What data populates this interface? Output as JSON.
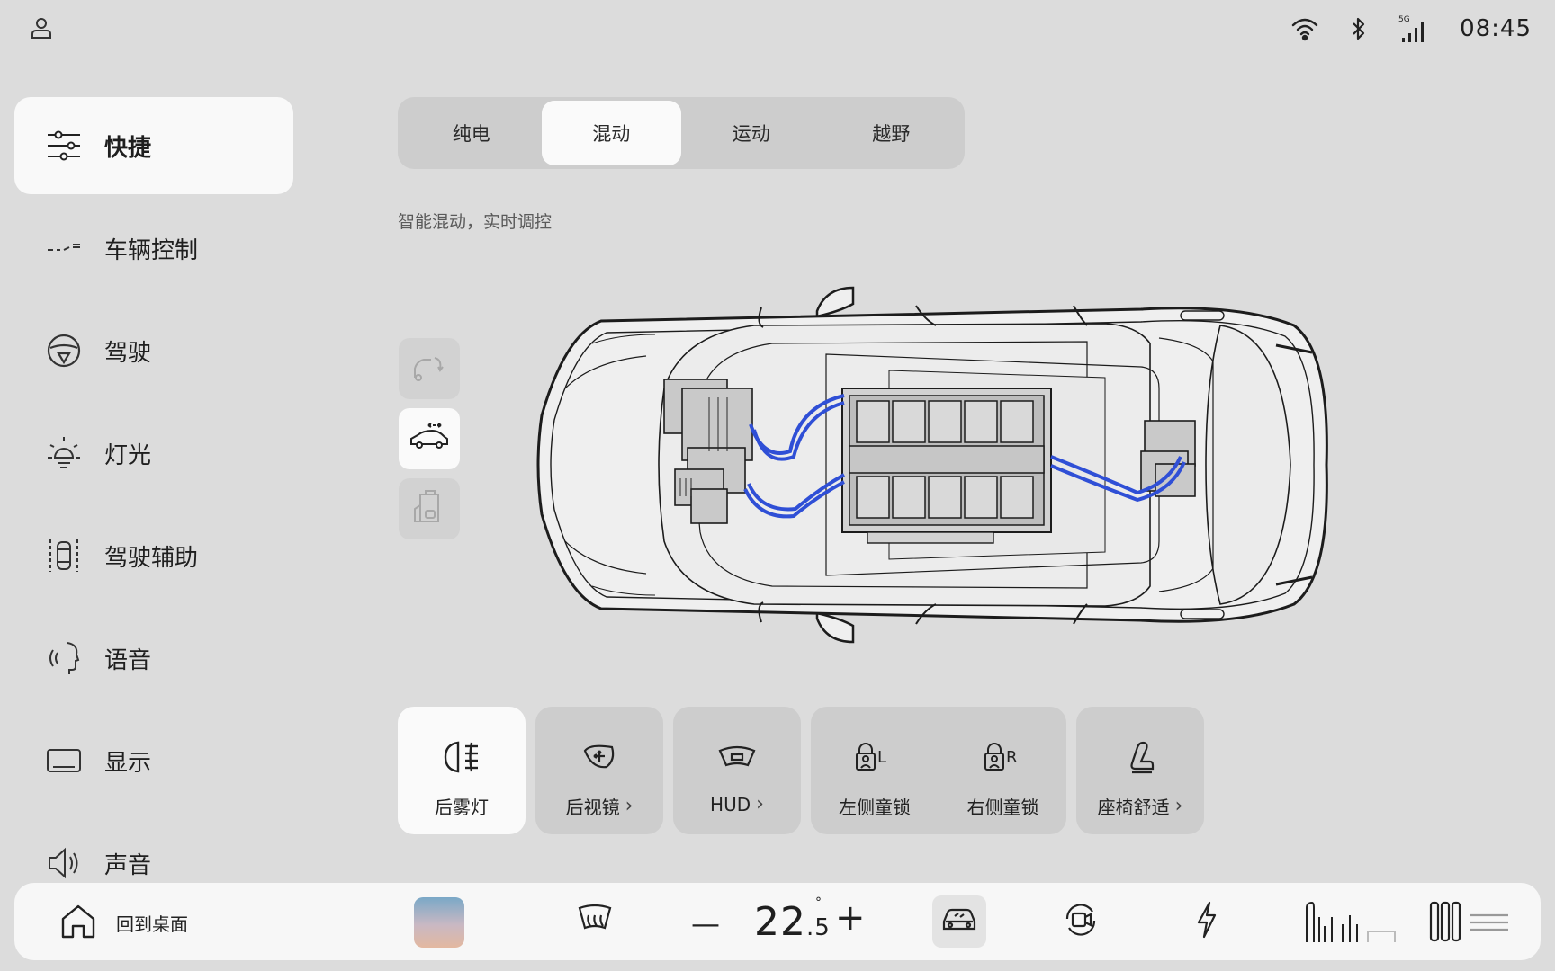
{
  "status": {
    "time": "08:45",
    "network": "5G",
    "icons": [
      "user-icon",
      "wifi-icon",
      "bluetooth-icon",
      "signal-5g-icon"
    ]
  },
  "sidebar": {
    "items": [
      {
        "label": "快捷",
        "icon": "sliders-icon",
        "active": true
      },
      {
        "label": "车辆控制",
        "icon": "vehicle-control-icon"
      },
      {
        "label": "驾驶",
        "icon": "steering-wheel-icon"
      },
      {
        "label": "灯光",
        "icon": "light-icon"
      },
      {
        "label": "驾驶辅助",
        "icon": "driver-assist-icon"
      },
      {
        "label": "语音",
        "icon": "voice-icon"
      },
      {
        "label": "显示",
        "icon": "display-icon"
      },
      {
        "label": "声音",
        "icon": "speaker-icon"
      }
    ]
  },
  "modes": {
    "tabs": [
      "纯电",
      "混动",
      "运动",
      "越野"
    ],
    "selected": "混动",
    "description": "智能混动，实时调控"
  },
  "view_buttons": [
    "car-rear-icon",
    "car-side-icon",
    "car-door-icon"
  ],
  "quick": {
    "items": [
      {
        "label": "后雾灯",
        "icon": "rear-fog-light-icon",
        "active": true
      },
      {
        "label": "后视镜",
        "icon": "mirror-icon",
        "chevron": "›"
      },
      {
        "label": "HUD",
        "icon": "hud-icon",
        "chevron": "›"
      },
      {
        "label": "左侧童锁",
        "icon": "child-lock-left-icon"
      },
      {
        "label": "右侧童锁",
        "icon": "child-lock-right-icon"
      },
      {
        "label": "座椅舒适",
        "icon": "seat-icon",
        "chevron": "›"
      }
    ]
  },
  "dock": {
    "home_label": "回到桌面",
    "temperature_int": "22",
    "temperature_dec": ".5",
    "degree": "°",
    "minus": "—",
    "plus": "+",
    "icons": [
      "home-icon",
      "media-thumbnail",
      "rear-defrost-icon",
      "car-icon",
      "camera-rotate-icon",
      "charge-icon",
      "seat-heat-icon",
      "fan-icon"
    ]
  },
  "colors": {
    "accent_cable": "#2f4fd6",
    "active_bg": "#fafafa",
    "panel_bg": "#cdcdcd"
  }
}
